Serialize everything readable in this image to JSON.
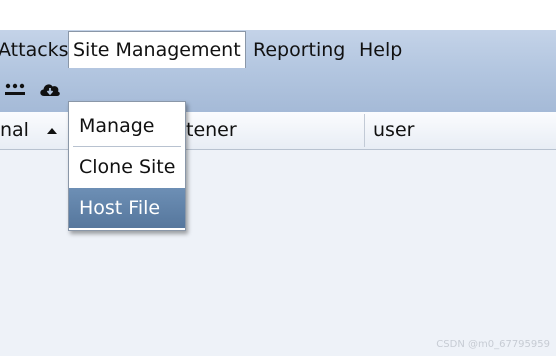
{
  "menubar": {
    "items": [
      {
        "label": "Attacks"
      },
      {
        "label": "Site Management"
      },
      {
        "label": "Reporting"
      },
      {
        "label": "Help"
      }
    ],
    "open_item": "Site Management"
  },
  "toolbar": {
    "icons": [
      "more-icon",
      "cloud-download-icon"
    ]
  },
  "table": {
    "columns": [
      {
        "label": "nal",
        "sort": "ascending"
      },
      {
        "label": "tener"
      },
      {
        "label": "user"
      }
    ]
  },
  "dropdown": {
    "items": [
      {
        "label": "Manage"
      },
      {
        "label": "Clone Site"
      },
      {
        "label": "Host File",
        "selected": true
      }
    ]
  },
  "watermark": "CSDN @m0_67795959",
  "colors": {
    "menubar": "#c4d3e8",
    "selected": "#5f82a8",
    "background": "#eef2f8"
  }
}
